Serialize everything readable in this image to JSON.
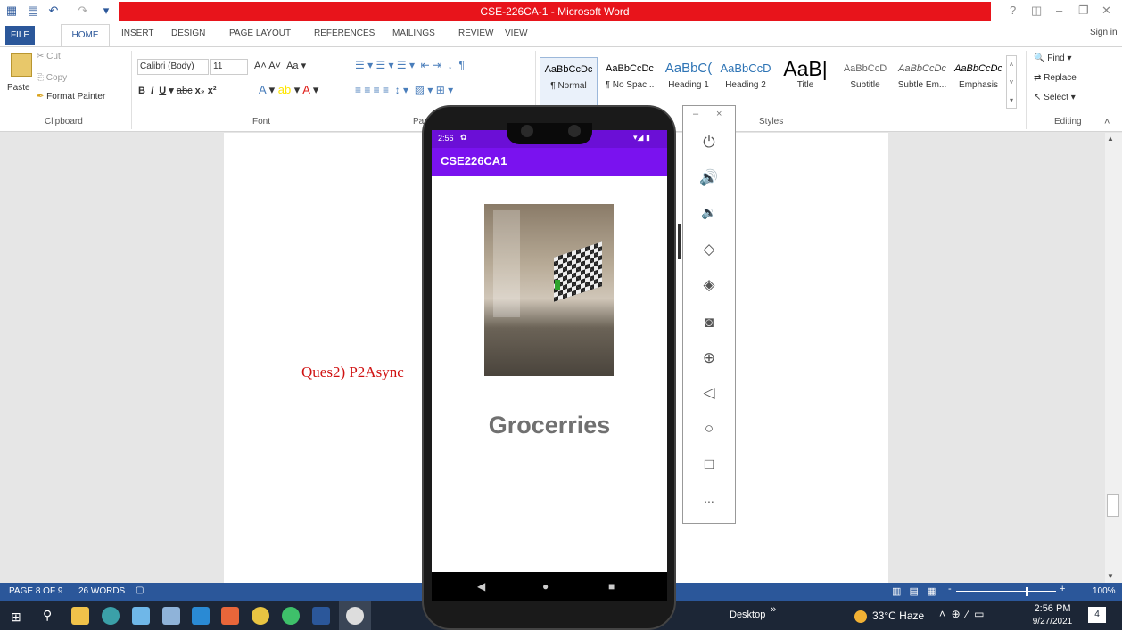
{
  "window": {
    "title": "CSE-226CA-1 - Microsoft Word",
    "help": "?",
    "sign_in": "Sign in"
  },
  "tabs": [
    "FILE",
    "HOME",
    "INSERT",
    "DESIGN",
    "PAGE LAYOUT",
    "REFERENCES",
    "MAILINGS",
    "REVIEW",
    "VIEW"
  ],
  "clipboard": {
    "paste": "Paste",
    "cut": "Cut",
    "copy": "Copy",
    "format_painter": "Format Painter",
    "group": "Clipboard"
  },
  "font": {
    "name": "Calibri (Body)",
    "size": "11",
    "group": "Font"
  },
  "paragraph": {
    "group": "Par"
  },
  "styles": {
    "items": [
      {
        "sample": "AaBbCcDc",
        "name": "¶ Normal"
      },
      {
        "sample": "AaBbCcDc",
        "name": "¶ No Spac..."
      },
      {
        "sample": "AaBbC(",
        "name": "Heading 1"
      },
      {
        "sample": "AaBbCcD",
        "name": "Heading 2"
      },
      {
        "sample": "AaB|",
        "name": "Title"
      },
      {
        "sample": "AaBbCcD",
        "name": "Subtitle"
      },
      {
        "sample": "AaBbCcDc",
        "name": "Subtle Em..."
      },
      {
        "sample": "AaBbCcDc",
        "name": "Emphasis"
      }
    ],
    "group": "Styles"
  },
  "editing": {
    "find": "Find",
    "replace": "Replace",
    "select": "Select",
    "group": "Editing"
  },
  "document": {
    "text": "Ques2) P2Async"
  },
  "statusbar": {
    "page": "PAGE 8 OF 9",
    "words": "26 WORDS",
    "zoom": "100%"
  },
  "phone": {
    "time": "2:56",
    "app_title": "CSE226CA1",
    "label": "Grocerries"
  },
  "emulator": {
    "minimize": "–",
    "close": "×",
    "more": "..."
  },
  "taskbar": {
    "desktop": "Desktop",
    "weather": "33°C Haze",
    "time": "2:56 PM",
    "date": "9/27/2021",
    "notif_count": "4"
  }
}
